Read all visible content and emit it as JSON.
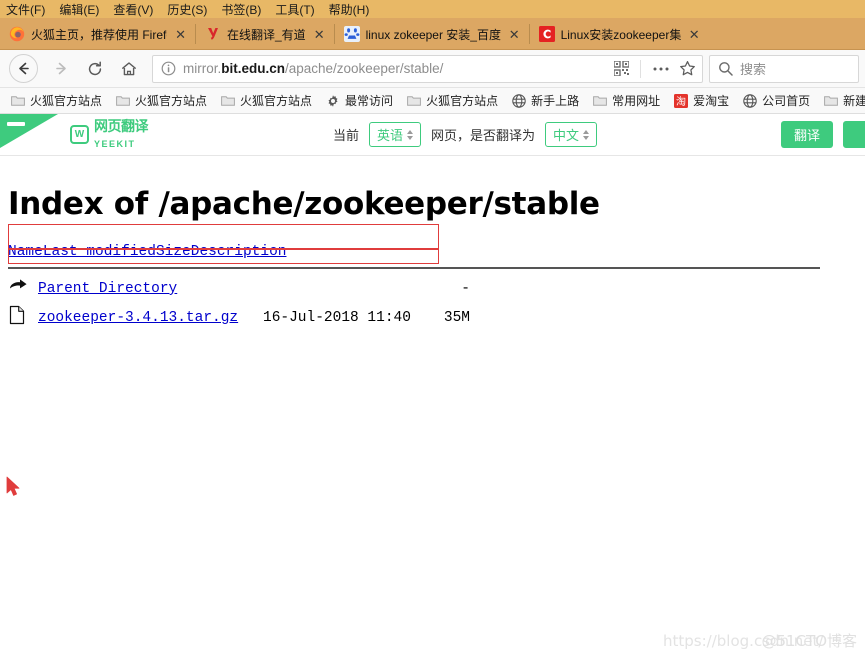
{
  "browser": {
    "menubar": [
      "文件(F)",
      "编辑(E)",
      "查看(V)",
      "历史(S)",
      "书签(B)",
      "工具(T)",
      "帮助(H)"
    ],
    "tabs": [
      {
        "title": "火狐主页，推荐使用 Firefox ›",
        "favicon": "firefox-icon",
        "active": false,
        "close_label": "✕"
      },
      {
        "title": "在线翻译_有道",
        "favicon": "youdao-icon",
        "active": false,
        "close_label": "✕"
      },
      {
        "title": "linux zokeeper 安装_百度搜索",
        "favicon": "baidu-icon",
        "active": false,
        "close_label": "✕"
      },
      {
        "title": "Linux安装zookeeper集群(Cer",
        "favicon": "csdn-icon",
        "active": true,
        "close_label": "✕"
      }
    ],
    "nav": {
      "back_label": "←",
      "forward_label": "→",
      "reload_label": "⟳",
      "home_label": "⌂"
    },
    "url": {
      "info_icon": "info-icon",
      "prefix": "mirror.",
      "host": "bit.edu.cn",
      "path": "/apache/zookeeper/stable/",
      "qr_icon": "qr-code-icon",
      "menu_icon": "ellipsis-icon",
      "bookmark_icon": "star-icon"
    },
    "search": {
      "icon": "search-icon",
      "placeholder": "搜索"
    },
    "bookmarks": [
      {
        "label": "火狐官方站点",
        "icon": "folder-icon"
      },
      {
        "label": "火狐官方站点",
        "icon": "folder-icon"
      },
      {
        "label": "火狐官方站点",
        "icon": "folder-icon"
      },
      {
        "label": "最常访问",
        "icon": "gear-icon"
      },
      {
        "label": "火狐官方站点",
        "icon": "folder-icon"
      },
      {
        "label": "新手上路",
        "icon": "globe-icon"
      },
      {
        "label": "常用网址",
        "icon": "folder-icon"
      },
      {
        "label": "爱淘宝",
        "icon": "taobao-icon"
      },
      {
        "label": "公司首页",
        "icon": "globe-icon"
      },
      {
        "label": "新建文",
        "icon": "folder-icon"
      }
    ]
  },
  "translate_bar": {
    "brand_cn": "网页翻译",
    "brand_en": "YEEKIT",
    "brand_mark": "W",
    "current_label": "当前",
    "source_lang": "英语",
    "middle_label": "网页，是否翻译为",
    "target_lang": "中文",
    "translate_button": "翻译",
    "secondary_button": ""
  },
  "page": {
    "title": "Index of /apache/zookeeper/stable",
    "columns": [
      "Name",
      "Last modified",
      "Size",
      "Description"
    ],
    "rows": [
      {
        "icon": "parent-directory-icon",
        "name": "Parent Directory",
        "last_modified": "",
        "size": "-",
        "description": ""
      },
      {
        "icon": "archive-file-icon",
        "name": "zookeeper-3.4.13.tar.gz",
        "last_modified": "16-Jul-2018 11:40",
        "size": "35M",
        "description": ""
      }
    ],
    "annotations": {
      "highlight_color": "#e03c3c",
      "boxes": [
        {
          "name": "zookeeper-row-highlight"
        },
        {
          "name": "below-row-highlight"
        }
      ]
    },
    "watermark_1": "https://blog.csdn.net/",
    "watermark_2": "@51CTO博客"
  }
}
